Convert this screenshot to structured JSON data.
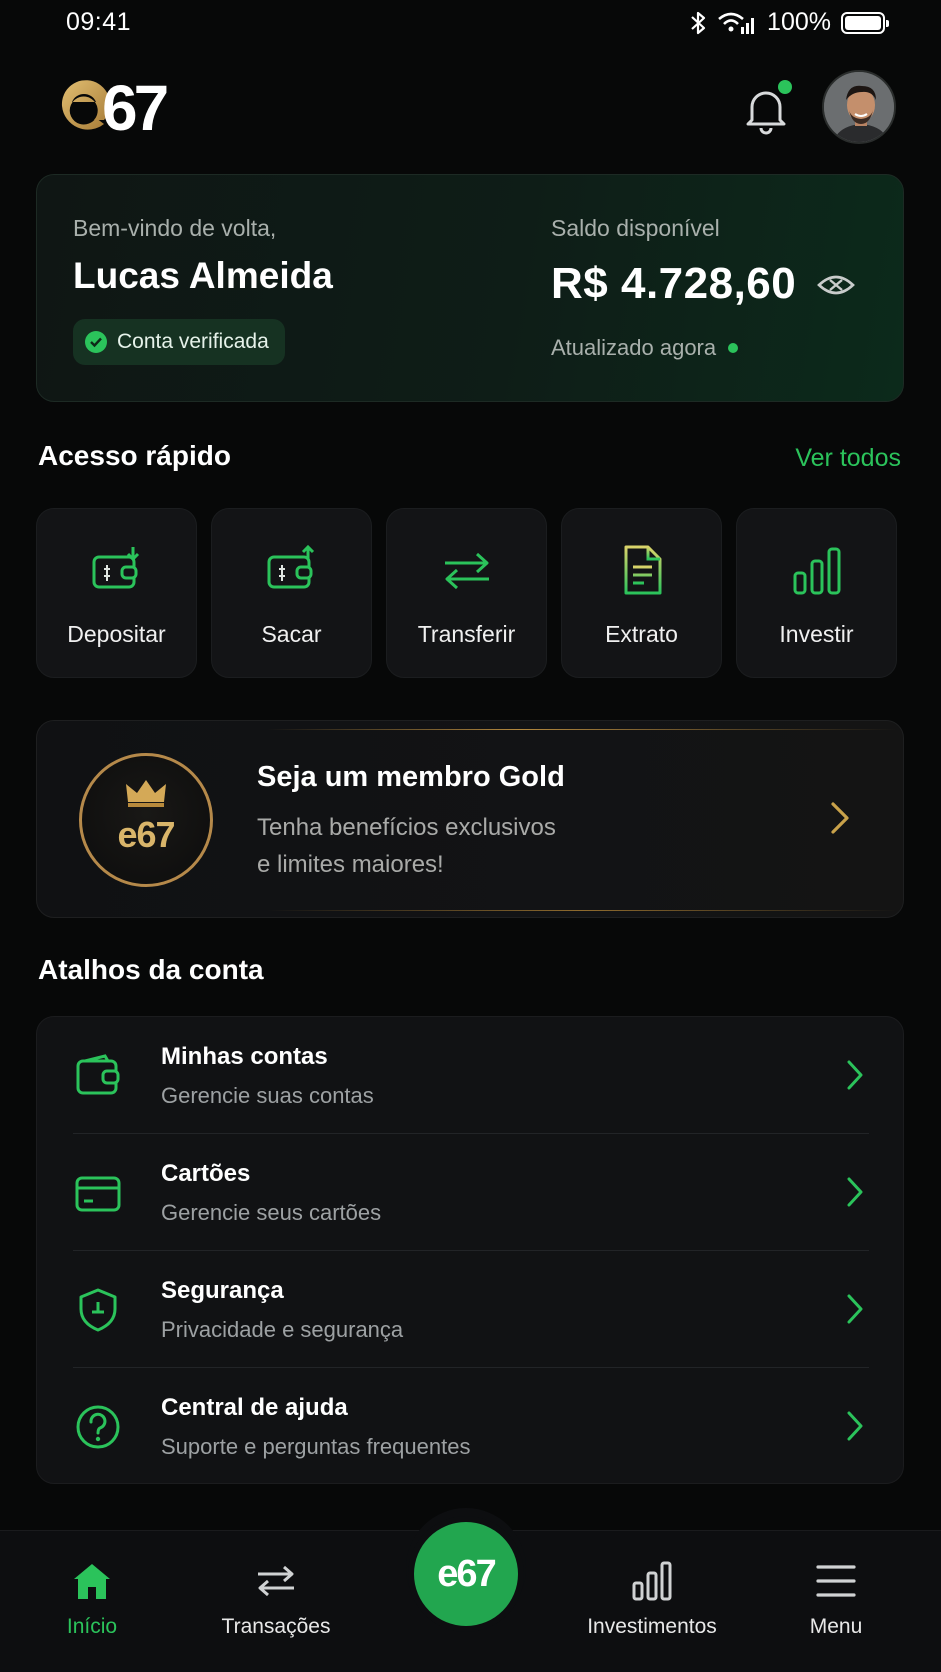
{
  "status_bar": {
    "time": "09:41",
    "battery": "100%"
  },
  "header": {
    "logo_text": "e67",
    "notification_dot_color": "#2bc35b"
  },
  "welcome": {
    "greeting": "Bem-vindo de volta,",
    "name": "Lucas Almeida",
    "verified_label": "Conta verificada",
    "balance_label": "Saldo disponível",
    "balance": "R$ 4.728,60",
    "updated": "Atualizado agora"
  },
  "quick_access": {
    "title": "Acesso rápido",
    "see_all": "Ver todos",
    "items": [
      {
        "label": "Depositar",
        "icon": "deposit-icon"
      },
      {
        "label": "Sacar",
        "icon": "withdraw-icon"
      },
      {
        "label": "Transferir",
        "icon": "transfer-icon"
      },
      {
        "label": "Extrato",
        "icon": "statement-icon"
      },
      {
        "label": "Investir",
        "icon": "invest-icon"
      }
    ]
  },
  "gold_banner": {
    "title": "Seja um membro Gold",
    "subtitle_line1": "Tenha benefícios exclusivos",
    "subtitle_line2": "e limites maiores!",
    "badge_text": "e67",
    "accent": "#c9a24a"
  },
  "shortcuts": {
    "title": "Atalhos da conta",
    "items": [
      {
        "title": "Minhas contas",
        "subtitle": "Gerencie suas contas",
        "icon": "wallet-icon"
      },
      {
        "title": "Cartões",
        "subtitle": "Gerencie seus cartões",
        "icon": "card-icon"
      },
      {
        "title": "Segurança",
        "subtitle": "Privacidade e segurança",
        "icon": "shield-icon"
      },
      {
        "title": "Central de ajuda",
        "subtitle": "Suporte e perguntas frequentes",
        "icon": "help-icon"
      }
    ]
  },
  "bottom_nav": {
    "items": [
      {
        "label": "Início",
        "icon": "home-icon",
        "active": true
      },
      {
        "label": "Transações",
        "icon": "transactions-icon",
        "active": false
      },
      {
        "label": "Investimentos",
        "icon": "investments-icon",
        "active": false
      },
      {
        "label": "Menu",
        "icon": "menu-icon",
        "active": false
      }
    ],
    "center_button_text": "e67"
  },
  "colors": {
    "accent_green": "#2bc35b",
    "gold": "#c9a24a",
    "background": "#070808"
  }
}
